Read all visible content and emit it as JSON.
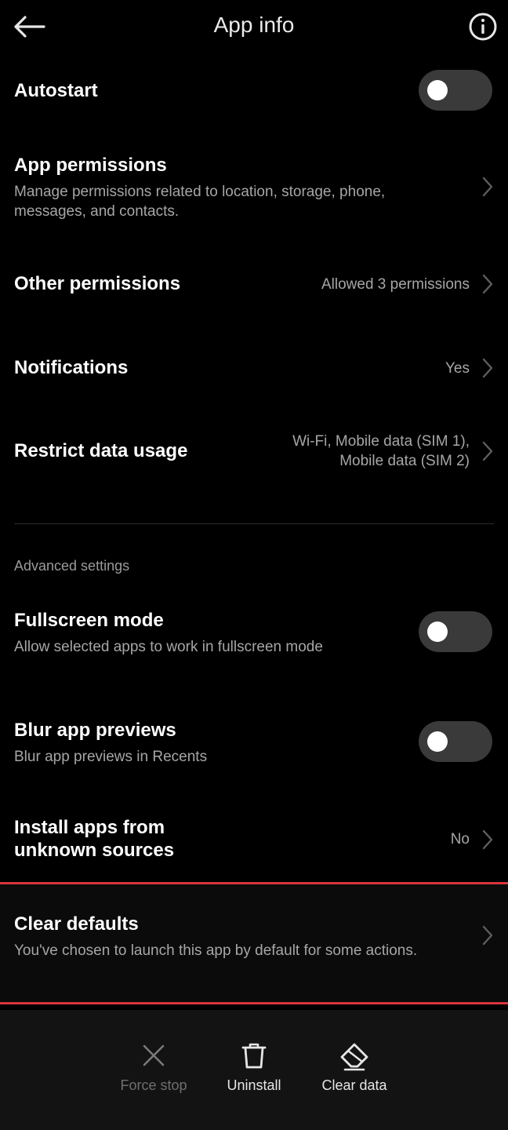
{
  "header": {
    "title": "App info"
  },
  "rows": {
    "autostart": {
      "title": "Autostart",
      "enabled": false
    },
    "app_permissions": {
      "title": "App permissions",
      "subtitle_line1": "Manage permissions related to location, storage, phone,",
      "subtitle_line2": "messages, and contacts."
    },
    "other_permissions": {
      "title": "Other permissions",
      "value": "Allowed 3 permissions"
    },
    "notifications": {
      "title": "Notifications",
      "value": "Yes"
    },
    "restrict_data": {
      "title": "Restrict data usage",
      "value_line1": "Wi-Fi, Mobile data (SIM 1),",
      "value_line2": "Mobile data (SIM 2)"
    }
  },
  "advanced": {
    "section_label": "Advanced settings",
    "fullscreen": {
      "title": "Fullscreen mode",
      "subtitle": "Allow selected apps to work in fullscreen mode",
      "enabled": false
    },
    "blur": {
      "title": "Blur app previews",
      "subtitle": "Blur app previews in Recents",
      "enabled": false
    },
    "unknown_sources": {
      "title_line1": "Install apps from",
      "title_line2": "unknown sources",
      "value": "No"
    },
    "clear_defaults": {
      "title": "Clear defaults",
      "subtitle": "You've chosen to launch this app by default for some actions."
    }
  },
  "actions": [
    {
      "label": "Force stop",
      "icon": "close-icon",
      "enabled": false
    },
    {
      "label": "Uninstall",
      "icon": "trash-icon",
      "enabled": true
    },
    {
      "label": "Clear data",
      "icon": "eraser-icon",
      "enabled": true
    }
  ],
  "colors": {
    "accent_highlight": "#d9343c",
    "muted_text": "#a6a6a6",
    "disabled_text": "#6f6f6f"
  }
}
